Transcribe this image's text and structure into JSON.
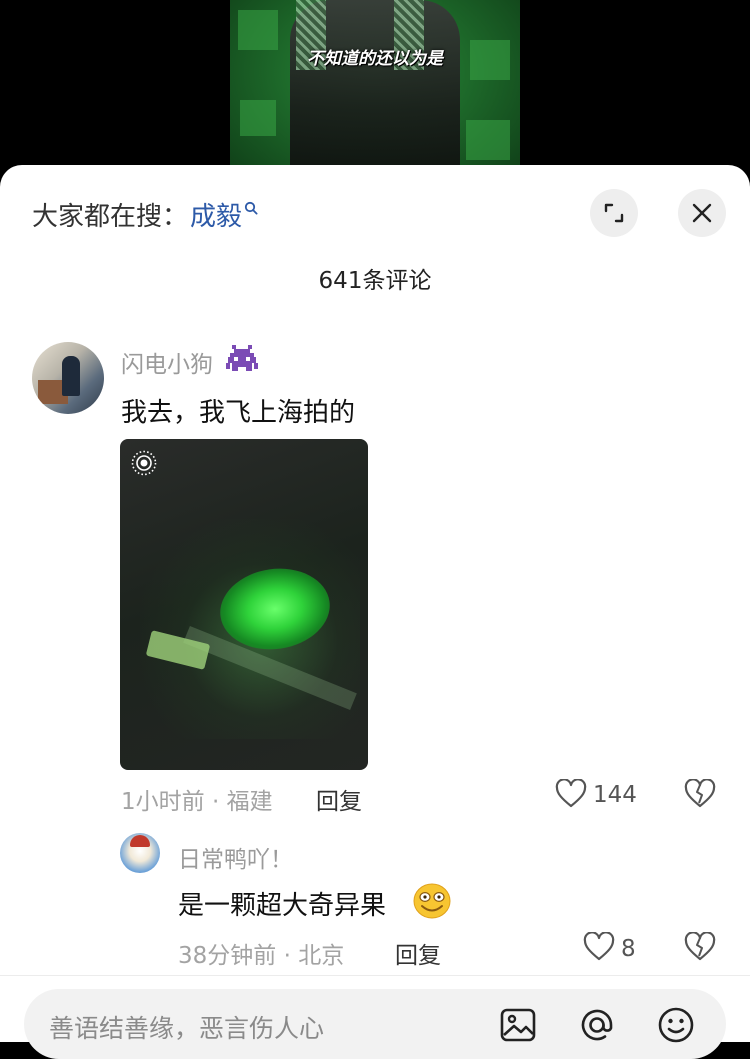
{
  "video": {
    "subtitle": "不知道的还以为是"
  },
  "header": {
    "search_prefix": "大家都在搜：",
    "search_term": "成毅",
    "comment_count": "641条评论"
  },
  "comments": [
    {
      "user": "闪电小狗",
      "text": "我去，我飞上海拍的",
      "meta": "1小时前 · 福建",
      "reply_label": "回复",
      "likes": "144",
      "has_image": true,
      "name_icon": "alien-monster-icon"
    }
  ],
  "replies": [
    {
      "user": "日常鸭吖！",
      "text": "是一颗超大奇异果",
      "emoji": "smiling-face-icon",
      "meta": "38分钟前 · 北京",
      "reply_label": "回复",
      "likes": "8"
    }
  ],
  "input": {
    "placeholder": "善语结善缘，恶言伤人心"
  },
  "colors": {
    "accent": "#2d5aa8",
    "muted": "#9a9a9a",
    "sheet_bg": "#ffffff"
  }
}
